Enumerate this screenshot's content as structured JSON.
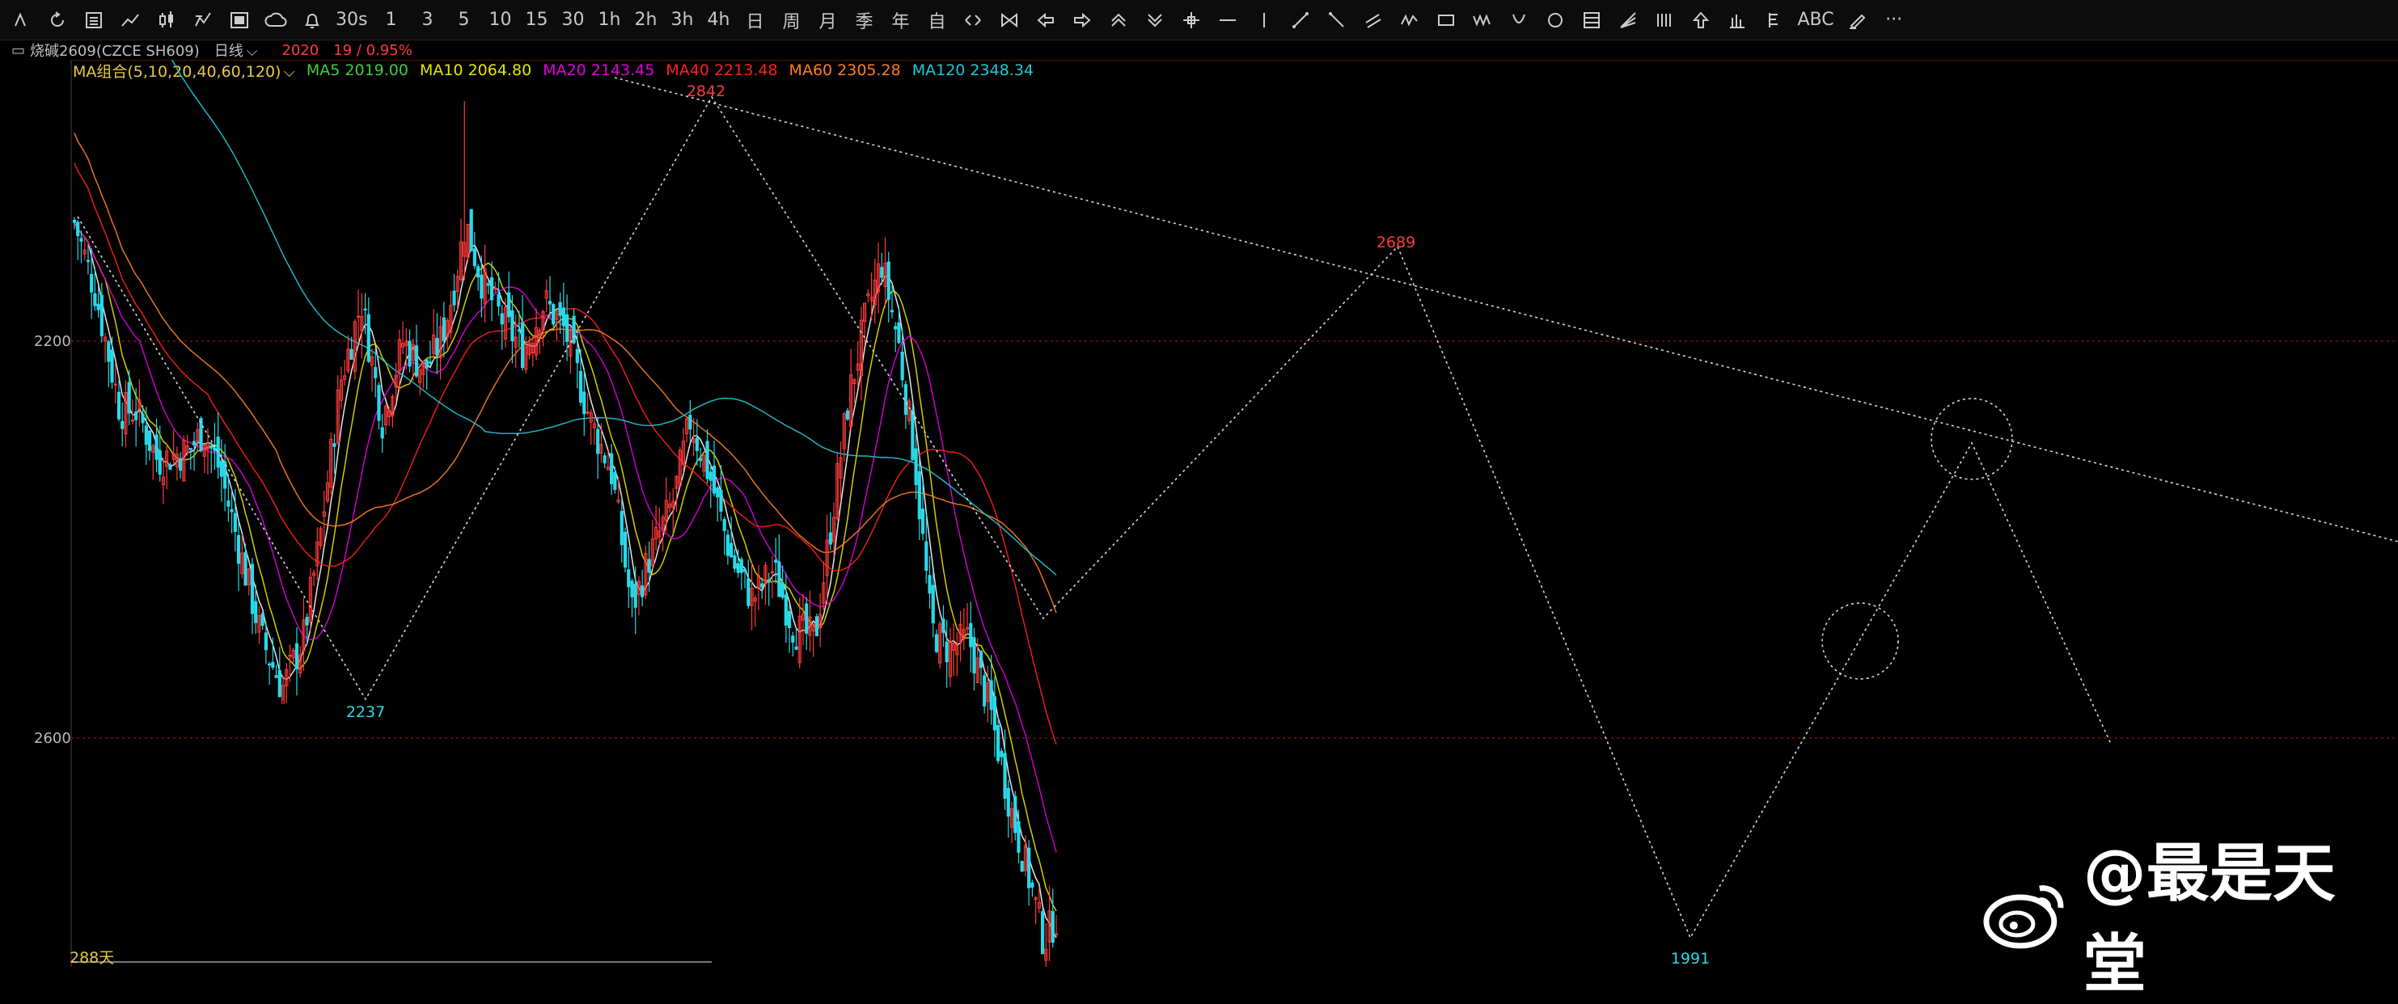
{
  "toolbar": {
    "interval_buttons": [
      "30s",
      "1",
      "3",
      "5",
      "10",
      "15",
      "30",
      "1h",
      "2h",
      "3h",
      "4h",
      "日",
      "周",
      "月",
      "季",
      "年",
      "自"
    ],
    "abc_label": "ABC",
    "more_label": "···"
  },
  "infobar": {
    "instrument": "烧碱2609(CZCE SH609)",
    "period": "日线",
    "price": "2020",
    "change": "19 / 0.95%"
  },
  "ma": {
    "combo_label": "MA组合(5,10,20,40,60,120)",
    "ma5": "MA5 2019.00",
    "ma10": "MA10 2064.80",
    "ma20": "MA20 2143.45",
    "ma40": "MA40 2213.48",
    "ma60": "MA60 2305.28",
    "ma120": "MA120 2348.34"
  },
  "colors": {
    "up": "#ff3b3b",
    "down": "#29d9e8",
    "ma5": "#ffffff",
    "ma10": "#e6e600",
    "ma20": "#e000e0",
    "ma40": "#ff2020",
    "ma60": "#ff7f20",
    "ma120": "#20c8d8",
    "grid": "#7a1010"
  },
  "yaxis": {
    "labels": [
      "2600",
      "2200"
    ]
  },
  "annotations": {
    "high_label": "2842",
    "low1_label": "2237",
    "peak2_label": "2689",
    "low2_label": "1991"
  },
  "footer": {
    "days": "288天"
  },
  "watermark": {
    "text": "@最是天堂"
  },
  "chart_data": {
    "type": "candlestick",
    "period": "daily",
    "bars": 288,
    "ylim": [
      1960,
      2930
    ],
    "y_ticks": [
      2200,
      2600
    ],
    "series_close_trace": [
      [
        0,
        2720
      ],
      [
        10,
        2650
      ],
      [
        22,
        2530
      ],
      [
        30,
        2530
      ],
      [
        40,
        2480
      ],
      [
        55,
        2490
      ],
      [
        62,
        2510
      ],
      [
        70,
        2470
      ],
      [
        90,
        2300
      ],
      [
        100,
        2250
      ],
      [
        110,
        2300
      ],
      [
        118,
        2400
      ],
      [
        128,
        2560
      ],
      [
        138,
        2640
      ],
      [
        148,
        2520
      ],
      [
        158,
        2600
      ],
      [
        168,
        2570
      ],
      [
        176,
        2600
      ],
      [
        182,
        2650
      ],
      [
        188,
        2720
      ],
      [
        196,
        2660
      ],
      [
        206,
        2620
      ],
      [
        216,
        2590
      ],
      [
        226,
        2640
      ],
      [
        236,
        2610
      ],
      [
        248,
        2520
      ],
      [
        258,
        2470
      ],
      [
        268,
        2330
      ],
      [
        276,
        2380
      ],
      [
        288,
        2440
      ],
      [
        296,
        2520
      ],
      [
        306,
        2460
      ],
      [
        316,
        2380
      ],
      [
        326,
        2340
      ],
      [
        336,
        2370
      ],
      [
        346,
        2310
      ],
      [
        356,
        2300
      ],
      [
        364,
        2420
      ],
      [
        372,
        2540
      ],
      [
        380,
        2620
      ],
      [
        388,
        2680
      ],
      [
        396,
        2600
      ],
      [
        404,
        2480
      ],
      [
        412,
        2310
      ],
      [
        420,
        2290
      ],
      [
        430,
        2300
      ],
      [
        440,
        2230
      ],
      [
        450,
        2130
      ],
      [
        460,
        2050
      ],
      [
        466,
        1995
      ],
      [
        472,
        2020
      ]
    ],
    "markers": [
      {
        "label": "2842",
        "value": 2842
      },
      {
        "label": "2237",
        "value": 2237
      },
      {
        "label": "2689",
        "value": 2689
      },
      {
        "label": "1991",
        "value": 1991
      }
    ],
    "moving_averages": [
      "MA5",
      "MA10",
      "MA20",
      "MA40",
      "MA60",
      "MA120"
    ]
  }
}
